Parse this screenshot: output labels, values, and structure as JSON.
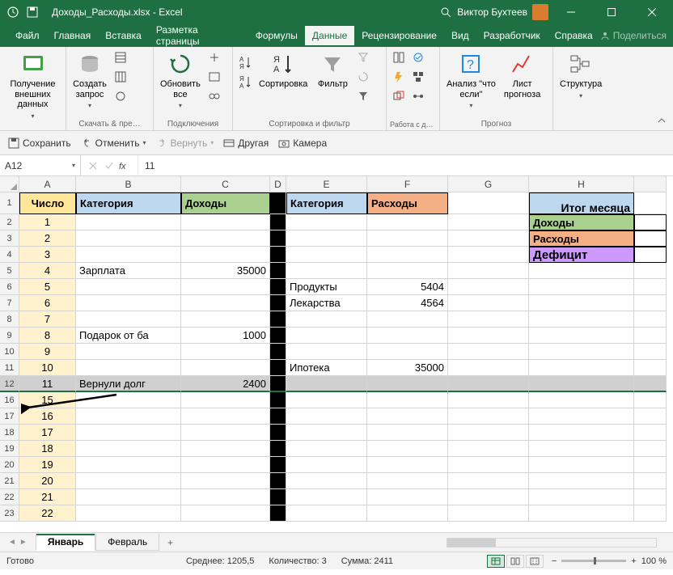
{
  "titlebar": {
    "filename": "Доходы_Расходы.xlsx  -  Excel",
    "user": "Виктор Бухтеев"
  },
  "menu": {
    "file": "Файл",
    "home": "Главная",
    "insert": "Вставка",
    "layout": "Разметка страницы",
    "formulas": "Формулы",
    "data": "Данные",
    "review": "Рецензирование",
    "view": "Вид",
    "developer": "Разработчик",
    "help": "Справка",
    "share": "Поделиться"
  },
  "ribbon": {
    "getdata": "Получение\nвнешних данных",
    "newquery": "Создать\nзапрос",
    "download_prep": "Скачать & пре…",
    "refresh": "Обновить\nвсе",
    "connections": "Подключения",
    "sort": "Сортировка",
    "filter": "Фильтр",
    "sortfilter": "Сортировка и фильтр",
    "datatools": "Работа с\nданными",
    "whatif": "Анализ \"что\nесли\"",
    "forecast_sheet": "Лист\nпрогноза",
    "forecast": "Прогноз",
    "structure": "Структура"
  },
  "quickaccess": {
    "save": "Сохранить",
    "undo": "Отменить",
    "redo": "Вернуть",
    "other": "Другая",
    "camera": "Камера"
  },
  "formulabar": {
    "namebox": "A12",
    "value": "11"
  },
  "cols": [
    "A",
    "B",
    "C",
    "D",
    "E",
    "F",
    "G",
    "H"
  ],
  "headers": {
    "number": "Число",
    "category": "Категория",
    "income": "Доходы",
    "expenses": "Расходы",
    "month_total": "Итог месяца",
    "income2": "Доходы",
    "expenses2": "Расходы",
    "deficit": "Дефицит"
  },
  "rows": [
    {
      "r": "2",
      "n": "1"
    },
    {
      "r": "3",
      "n": "2"
    },
    {
      "r": "4",
      "n": "3"
    },
    {
      "r": "5",
      "n": "4",
      "b": "Зарплата",
      "c": "35000"
    },
    {
      "r": "6",
      "n": "5",
      "e": "Продукты",
      "f": "5404"
    },
    {
      "r": "7",
      "n": "6",
      "e": "Лекарства",
      "f": "4564"
    },
    {
      "r": "8",
      "n": "7"
    },
    {
      "r": "9",
      "n": "8",
      "b": "Подарок от ба",
      "c": "1000"
    },
    {
      "r": "10",
      "n": "9"
    },
    {
      "r": "11",
      "n": "10",
      "e": "Ипотека",
      "f": "35000"
    },
    {
      "r": "12",
      "n": "11",
      "b": "Вернули долг",
      "c": "2400",
      "sel": true
    },
    {
      "r": "16",
      "n": "15"
    },
    {
      "r": "17",
      "n": "16"
    },
    {
      "r": "18",
      "n": "17"
    },
    {
      "r": "19",
      "n": "18"
    },
    {
      "r": "20",
      "n": "19"
    },
    {
      "r": "21",
      "n": "20"
    },
    {
      "r": "22",
      "n": "21"
    },
    {
      "r": "23",
      "n": "22"
    }
  ],
  "sheets": {
    "jan": "Январь",
    "feb": "Февраль"
  },
  "status": {
    "ready": "Готово",
    "avg": "Среднее: 1205,5",
    "count": "Количество: 3",
    "sum": "Сумма: 2411",
    "zoom": "100 %"
  }
}
